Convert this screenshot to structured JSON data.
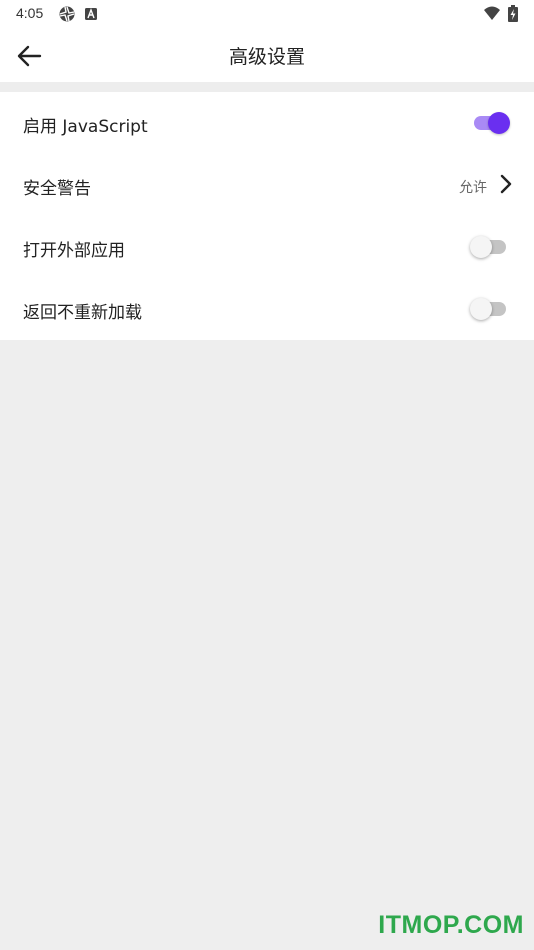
{
  "status_bar": {
    "time": "4:05",
    "left_icons": [
      "shutter-icon",
      "a-box-icon"
    ],
    "right_icons": [
      "wifi-icon",
      "battery-charging-icon"
    ]
  },
  "appbar": {
    "back_icon": "arrow-left-icon",
    "title": "高级设置"
  },
  "settings": [
    {
      "label": "启用 JavaScript",
      "control": "toggle",
      "on": true
    },
    {
      "label": "安全警告",
      "control": "value",
      "value": "允许",
      "icon": "chevron-right-icon"
    },
    {
      "label": "打开外部应用",
      "control": "toggle",
      "on": false
    },
    {
      "label": "返回不重新加载",
      "control": "toggle",
      "on": false
    }
  ],
  "colors": {
    "accent": "#6a2ff0",
    "accent_track": "#a98af5",
    "background": "#eeeeee",
    "watermark": "#2ea84d"
  },
  "watermark": "ITMOP.COM"
}
